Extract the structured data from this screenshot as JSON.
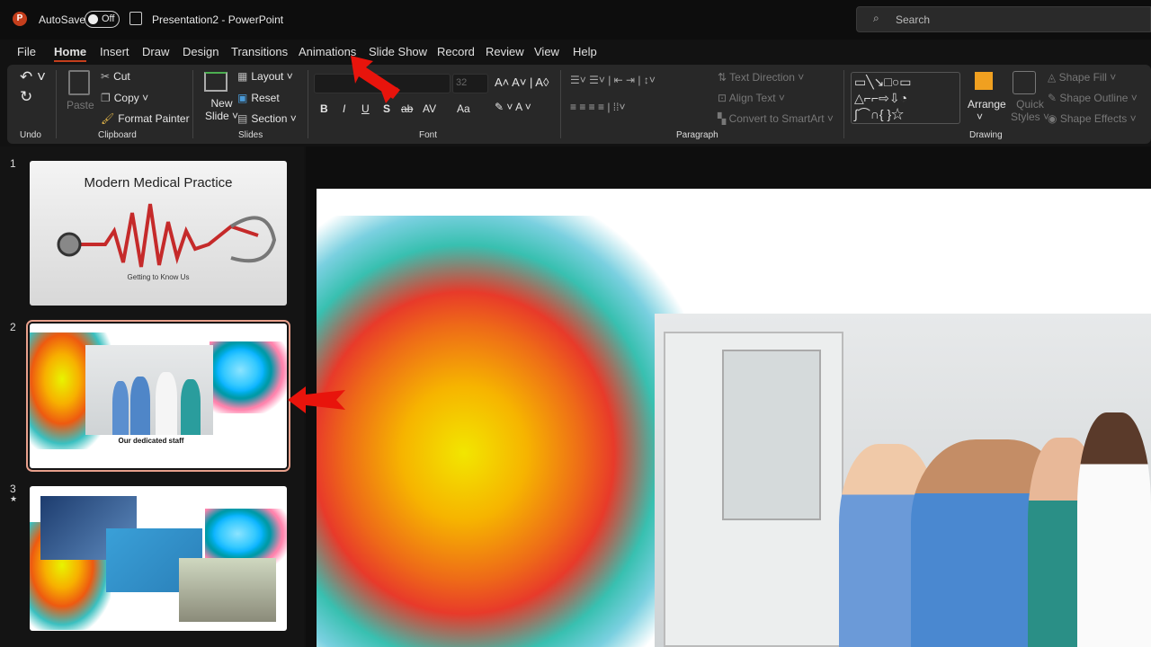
{
  "titlebar": {
    "app_icon": "powerpoint-logo",
    "autosave_label": "AutoSave",
    "autosave_state": "Off",
    "save_icon": "save-icon",
    "title": "Presentation2 - PowerPoint",
    "search_placeholder": "Search"
  },
  "menu": [
    "File",
    "Home",
    "Insert",
    "Draw",
    "Design",
    "Transitions",
    "Animations",
    "Slide Show",
    "Record",
    "Review",
    "View",
    "Help"
  ],
  "active_menu": "Home",
  "ribbon": {
    "undo": {
      "group": "Undo"
    },
    "clipboard": {
      "paste": "Paste",
      "cut": "Cut",
      "copy": "Copy",
      "format_painter": "Format Painter",
      "group": "Clipboard"
    },
    "slides": {
      "new_slide_1": "New",
      "new_slide_2": "Slide",
      "layout": "Layout",
      "reset": "Reset",
      "section": "Section",
      "group": "Slides"
    },
    "font": {
      "font_name": "",
      "font_size": "32",
      "bold": "B",
      "italic": "I",
      "underline": "U",
      "shadow": "S",
      "strike": "ab",
      "spacing": "AV",
      "case": "Aa",
      "group": "Font"
    },
    "paragraph": {
      "text_direction": "Text Direction",
      "align_text": "Align Text",
      "smartart": "Convert to SmartArt",
      "group": "Paragraph"
    },
    "drawing": {
      "arrange": "Arrange",
      "quick_styles_1": "Quick",
      "quick_styles_2": "Styles",
      "shape_fill": "Shape Fill",
      "shape_outline": "Shape Outline",
      "shape_effects": "Shape Effects",
      "group": "Drawing"
    }
  },
  "slides": [
    {
      "number": "1",
      "title": "Modern Medical Practice",
      "subtitle": "Getting to Know Us"
    },
    {
      "number": "2",
      "caption": "Our dedicated staff",
      "selected": true
    },
    {
      "number": "3",
      "star": "★"
    }
  ],
  "colors": {
    "accent": "#c43e1c",
    "annotation_arrow": "#e8140c"
  }
}
